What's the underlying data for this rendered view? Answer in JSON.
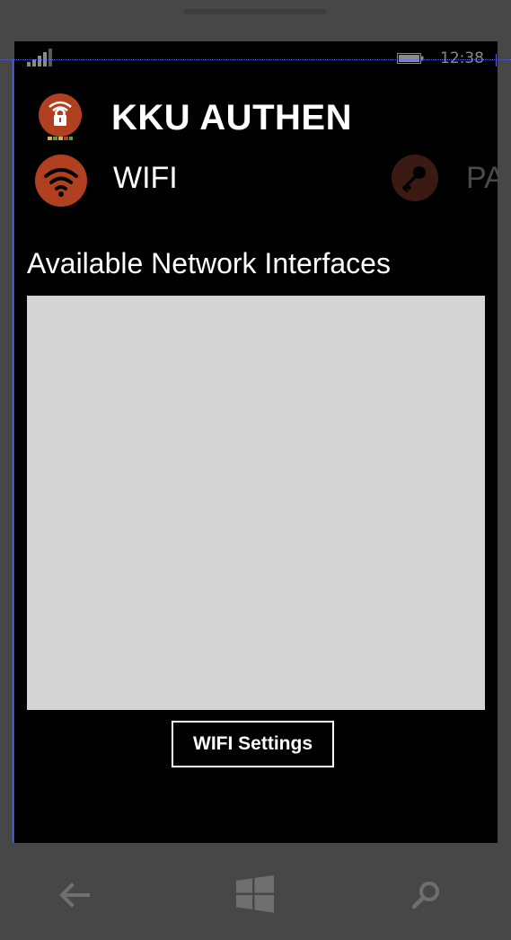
{
  "status_bar": {
    "time": "12:38",
    "signal_icon": "signal-strength-icon",
    "battery_icon": "battery-icon"
  },
  "app": {
    "title": "KKU AUTHEN",
    "logo_icon": "wifi-lock-logo-icon"
  },
  "pivot": {
    "items": [
      {
        "label": "WIFI",
        "icon": "wifi-icon",
        "active": true
      },
      {
        "label": "PA",
        "icon": "key-icon",
        "active": false
      }
    ]
  },
  "main": {
    "heading": "Available Network Interfaces",
    "interfaces": [],
    "wifi_settings_label": "WIFI Settings"
  },
  "nav": {
    "back_icon": "back-arrow-icon",
    "home_icon": "windows-logo-icon",
    "search_icon": "search-icon"
  },
  "colors": {
    "accent": "#b0401f",
    "accent_dim": "#3a1a12",
    "list_background": "#d4d4d4",
    "screen_background": "#000000",
    "frame": "#474747"
  }
}
